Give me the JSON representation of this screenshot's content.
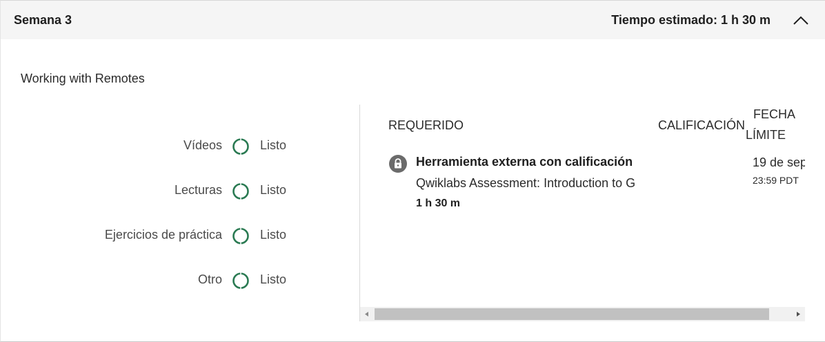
{
  "week": {
    "title": "Semana 3",
    "estimated_time": "Tiempo estimado: 1 h 30 m"
  },
  "module": {
    "title": "Working with Remotes"
  },
  "summary": [
    {
      "label": "Vídeos",
      "status": "Listo"
    },
    {
      "label": "Lecturas",
      "status": "Listo"
    },
    {
      "label": "Ejercicios de práctica",
      "status": "Listo"
    },
    {
      "label": "Otro",
      "status": "Listo"
    }
  ],
  "table": {
    "headers": {
      "required": "REQUERIDO",
      "grade": "CALIFICACIÓN",
      "due_line1": "FECHA",
      "due_line2": "LÍMITE"
    },
    "rows": [
      {
        "type": "Herramienta externa con calificación",
        "name": "Qwiklabs Assessment: Introduction to G",
        "duration": "1 h 30 m",
        "due_date": "19 de sep",
        "due_time": "23:59 PDT"
      }
    ]
  },
  "colors": {
    "accent_green": "#2a7a52",
    "header_bg": "#f5f5f5",
    "lock_gray": "#6b6b6b"
  },
  "icons": {
    "collapse": "chevron-up-icon",
    "status": "progress-ring-icon",
    "lock": "lock-icon"
  }
}
